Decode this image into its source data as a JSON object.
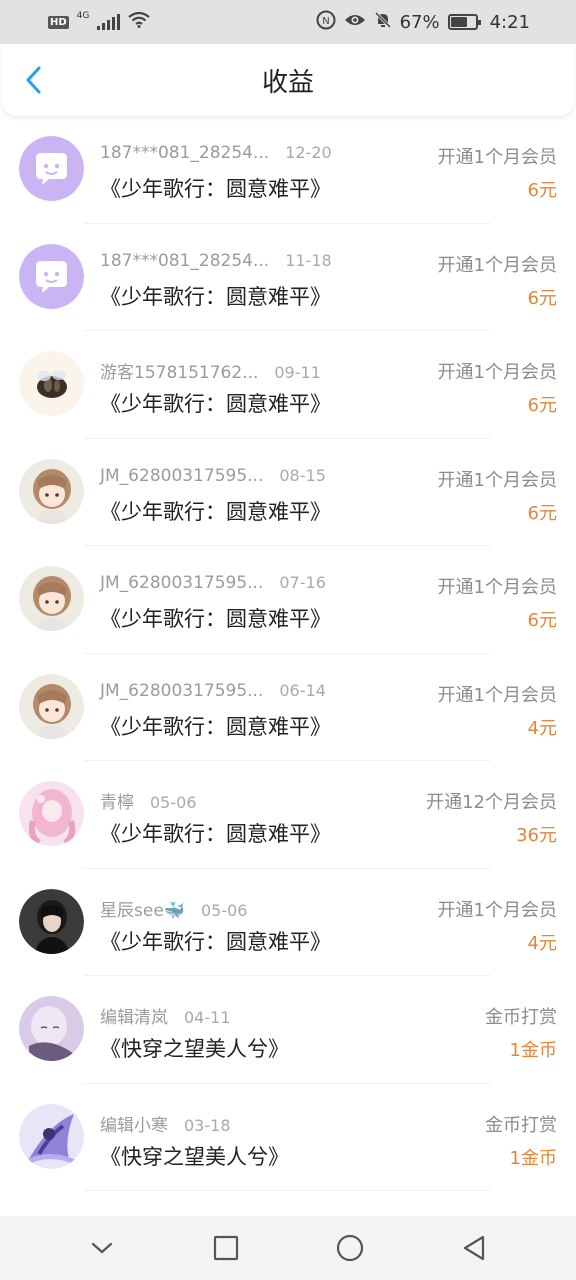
{
  "status_bar": {
    "network_badge": "HD",
    "network_type": "4G",
    "battery_text": "67%",
    "time": "4:21"
  },
  "header": {
    "title": "收益"
  },
  "records": [
    {
      "name": "187***081_28254...",
      "date": "12-20",
      "book": "《少年歌行：圆意难平》",
      "action": "开通1个月会员",
      "amount": "6元",
      "avatar": "chat-bubble"
    },
    {
      "name": "187***081_28254...",
      "date": "11-18",
      "book": "《少年歌行：圆意难平》",
      "action": "开通1个月会员",
      "amount": "6元",
      "avatar": "chat-bubble"
    },
    {
      "name": "游客1578151762...",
      "date": "09-11",
      "book": "《少年歌行：圆意难平》",
      "action": "开通1个月会员",
      "amount": "6元",
      "avatar": "bee"
    },
    {
      "name": "JM_62800317595...",
      "date": "08-15",
      "book": "《少年歌行：圆意难平》",
      "action": "开通1个月会员",
      "amount": "6元",
      "avatar": "anime-girl"
    },
    {
      "name": "JM_62800317595...",
      "date": "07-16",
      "book": "《少年歌行：圆意难平》",
      "action": "开通1个月会员",
      "amount": "6元",
      "avatar": "anime-girl"
    },
    {
      "name": "JM_62800317595...",
      "date": "06-14",
      "book": "《少年歌行：圆意难平》",
      "action": "开通1个月会员",
      "amount": "4元",
      "avatar": "anime-girl"
    },
    {
      "name": "青檸",
      "date": "05-06",
      "book": "《少年歌行：圆意难平》",
      "action": "开通12个月会员",
      "amount": "36元",
      "avatar": "pink-girl"
    },
    {
      "name": "星辰see🐳",
      "date": "05-06",
      "book": "《少年歌行：圆意难平》",
      "action": "开通1个月会员",
      "amount": "4元",
      "avatar": "dark-girl"
    },
    {
      "name": "编辑清岚",
      "date": "04-11",
      "book": "《快穿之望美人兮》",
      "action": "金币打赏",
      "amount": "1金币",
      "avatar": "lavender-girl"
    },
    {
      "name": "编辑小寒",
      "date": "03-18",
      "book": "《快穿之望美人兮》",
      "action": "金币打赏",
      "amount": "1金币",
      "avatar": "purple-fantasy"
    }
  ],
  "colors": {
    "accent": "#2a9ff0",
    "amount": "#e8843a",
    "secondary_text": "#9b9b9b"
  },
  "nav_bar": {
    "icons": [
      "chevron-down-icon",
      "square-icon",
      "circle-icon",
      "triangle-back-icon"
    ]
  }
}
